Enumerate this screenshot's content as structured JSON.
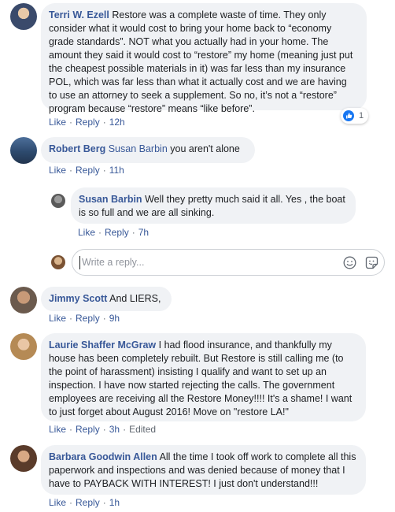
{
  "comments": [
    {
      "author": "Terri W. Ezell",
      "text": "Restore was a complete waste of time. They only consider what it would cost to bring your home back to “economy grade standards”. NOT what you actually had in your home. The amount they said it would cost to “restore” my home (meaning just put the cheapest possible materials in it) was far less than my insurance POL, which was far less than what it actually cost and we are having to use an attorney to seek a supplement. So no, it’s not a “restore” program because “restore” means “like before”.",
      "like": "Like",
      "reply": "Reply",
      "time": "12h",
      "reaction_count": "1"
    },
    {
      "author": "Robert Berg",
      "mention": "Susan Barbin",
      "text": "you aren't alone",
      "like": "Like",
      "reply": "Reply",
      "time": "11h"
    },
    {
      "author": "Susan Barbin",
      "text": "Well they pretty much said it all. Yes , the boat is so full and we are all sinking.",
      "like": "Like",
      "reply": "Reply",
      "time": "7h"
    },
    {
      "author": "Jimmy Scott",
      "text": "And LIERS,",
      "like": "Like",
      "reply": "Reply",
      "time": "9h"
    },
    {
      "author": "Laurie Shaffer McGraw",
      "text": "I had flood insurance, and thankfully my house has been completely rebuilt. But Restore is still calling me (to the point of harassment) insisting I qualify and want to set up an inspection. I have now started rejecting the calls. The government employees are receiving all the Restore Money!!!! It's a shame! I want to just forget about August 2016! Move on \"restore LA!\"",
      "like": "Like",
      "reply": "Reply",
      "time": "3h",
      "edited": "Edited"
    },
    {
      "author": "Barbara Goodwin Allen",
      "text": "All the time I took off work to complete all this paperwork and inspections and was denied because of money that I have to PAYBACK WITH INTEREST! I just don't understand!!!",
      "like": "Like",
      "reply": "Reply",
      "time": "1h"
    }
  ],
  "reply_box": {
    "placeholder": "Write a reply..."
  },
  "colors": {
    "link": "#385898",
    "bubble": "#f0f2f5",
    "meta": "#606770",
    "like_blue": "#1877f2"
  },
  "icons": [
    "like-reaction-icon",
    "emoji-icon",
    "sticker-icon"
  ]
}
